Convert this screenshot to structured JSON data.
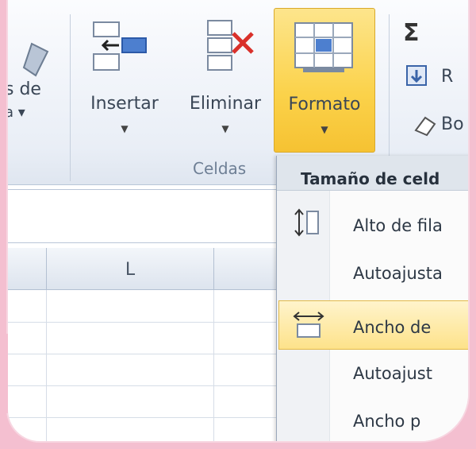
{
  "ribbon": {
    "partial_left_label_1": "s de",
    "partial_left_label_2": "a",
    "insertar_label": "Insertar",
    "eliminar_label": "Eliminar",
    "formato_label": "Formato",
    "group_label": "Celdas",
    "partial_right_1": "R",
    "partial_right_2": "Bo",
    "sigma": "Σ"
  },
  "grid": {
    "column_L": "L"
  },
  "menu": {
    "header": "Tamaño de celd",
    "items": [
      {
        "label": "Alto de fila"
      },
      {
        "label": "Autoajusta"
      },
      {
        "label": "Ancho de"
      },
      {
        "label": "Autoajust"
      },
      {
        "label": "Ancho p"
      }
    ]
  },
  "colors": {
    "accent": "#fbd24a",
    "highlight": "#fde28a",
    "background": "#f4bfd0"
  }
}
